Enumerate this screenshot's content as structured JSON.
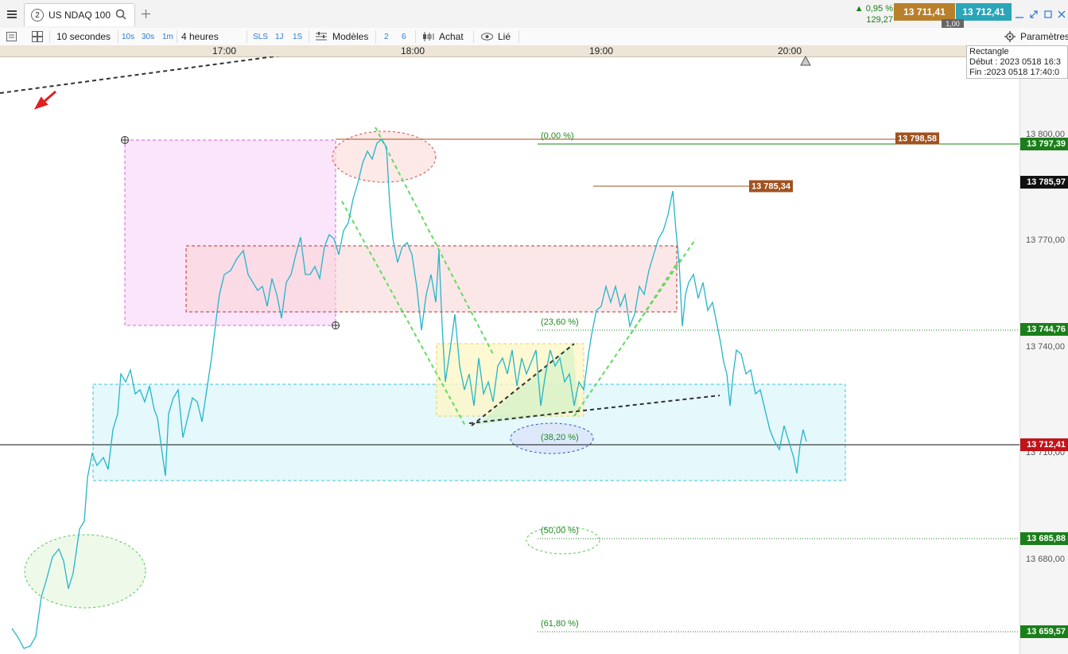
{
  "topbar": {
    "menu_icon": "hamburger-icon",
    "tab_number": "2",
    "instrument": "US NDAQ 100",
    "search_icon": "search-icon",
    "add_tab_icon": "plus-icon",
    "change_pct": "▲ 0,95 %",
    "change_abs": "129,27",
    "bid": "13 711,41",
    "ask": "13 712,41",
    "spread": "1,00",
    "window_icons": [
      "minimize-icon",
      "expand-icon",
      "restore-icon",
      "close-icon"
    ]
  },
  "toolbar": {
    "interval": "10 secondes",
    "quick_intervals": [
      "10s",
      "30s",
      "1m"
    ],
    "period": "4 heures",
    "quick_periods": [
      "SLS",
      "1J",
      "1S"
    ],
    "models_label": "Modèles",
    "num_a": "2",
    "num_b": "6",
    "achat_label": "Achat",
    "lie_label": "Lié",
    "params_label": "Paramètres"
  },
  "time_axis": {
    "ticks": [
      "17:00",
      "18:00",
      "19:00",
      "20:00"
    ]
  },
  "info_box": {
    "title": "Rectangle",
    "start": "Début : 2023 0518 16:3",
    "end": "Fin :2023 0518 17:40:0"
  },
  "price_axis": {
    "ticks": [
      "13 800,00",
      "13 770,00",
      "13 740,00",
      "13 710,00",
      "13 680,00"
    ],
    "tags": {
      "fib0": "13 797,39",
      "last_high": "13 785,97",
      "fib236": "13 744,76",
      "current": "13 712,41",
      "fib50": "13 685,88",
      "fib618": "13 659,57"
    }
  },
  "annotations": {
    "level_high1": "13 798,58",
    "level_high2": "13 785,34",
    "fib_0": "(0,00 %)",
    "fib_236": "(23,60 %)",
    "fib_382": "(38,20 %)",
    "fib_50": "(50,00 %)",
    "fib_618": "(61,80 %)"
  },
  "colors": {
    "bid": "#b8802c",
    "ask": "#2ba5b8",
    "green_tag": "#1a7f1a",
    "brown_tag": "#a0521f",
    "current_tag": "#c0141b",
    "dark_tag": "#111111"
  }
}
